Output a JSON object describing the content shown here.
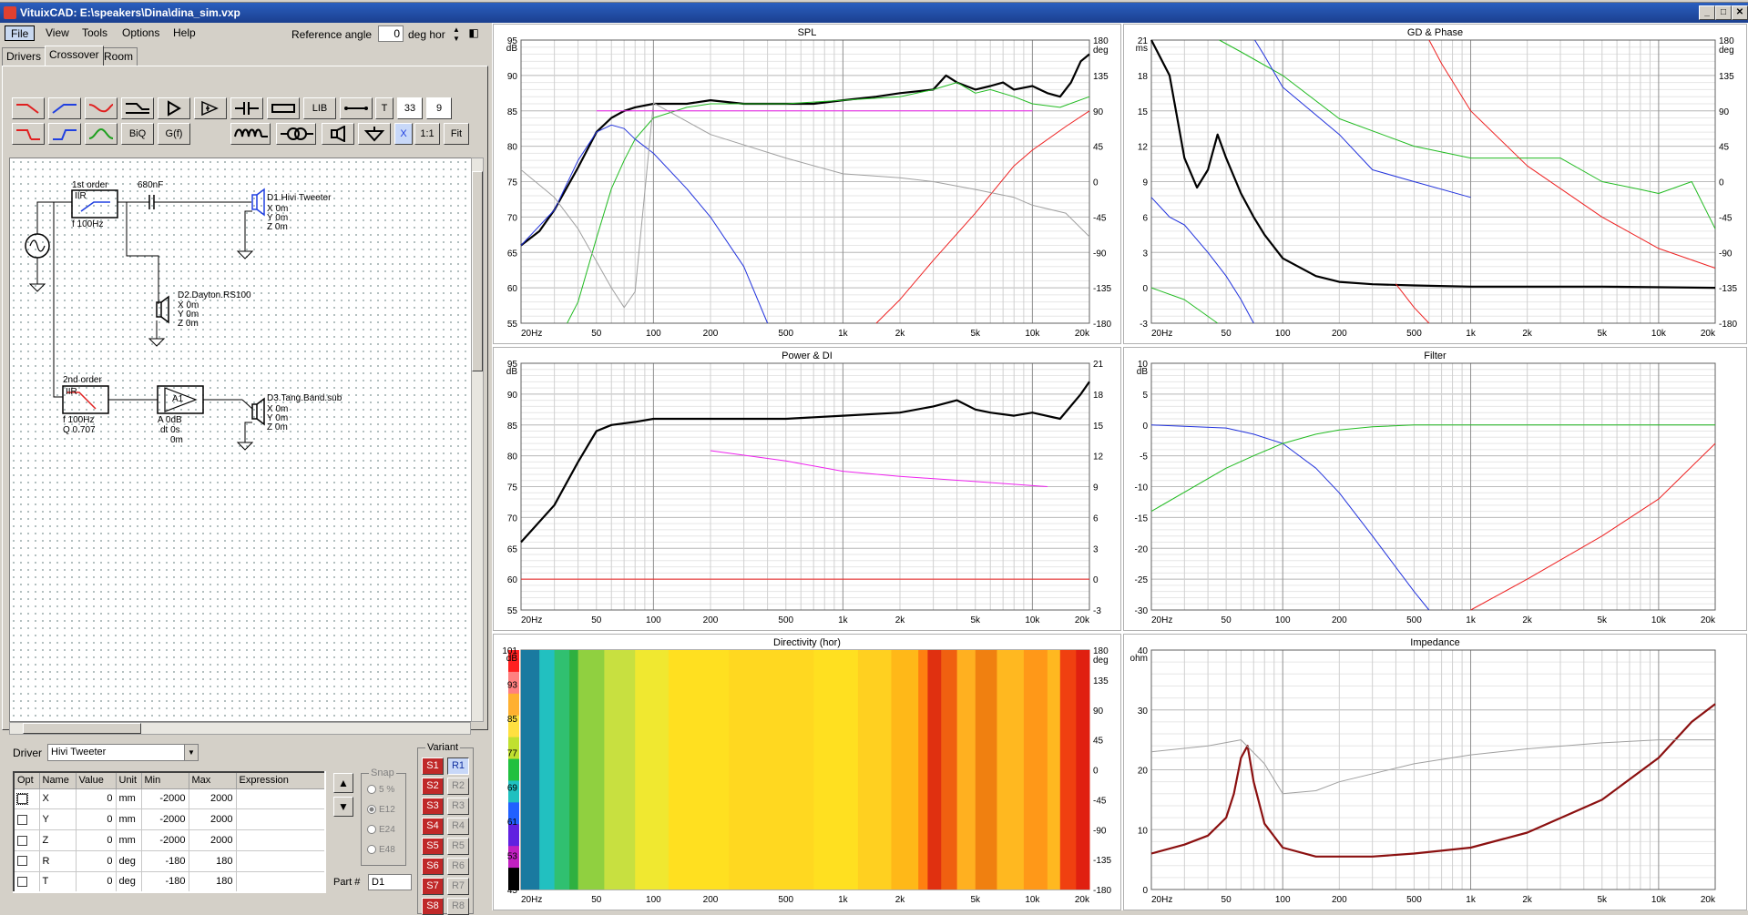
{
  "window": {
    "title": "VituixCAD: E:\\speakers\\Dina\\dina_sim.vxp",
    "controls": [
      "_",
      "□",
      "✕"
    ]
  },
  "menu": [
    "File",
    "View",
    "Tools",
    "Options",
    "Help"
  ],
  "reference": {
    "label": "Reference angle",
    "value": "0",
    "unit": "deg hor"
  },
  "tabs": [
    "Drivers",
    "Crossover",
    "Room"
  ],
  "toolbar": {
    "lib": "LIB",
    "t": "T",
    "num1": "33",
    "num2": "9",
    "biq": "BiQ",
    "gf": "G(f)",
    "onetoone": "1:1",
    "fit": "Fit",
    "x": "X"
  },
  "schematic": {
    "block1": {
      "title": "1st order",
      "type": "IIR",
      "freq": "f  100Hz"
    },
    "cap": "680nF",
    "driver1": {
      "name": "D1.Hivi Tweeter",
      "x": "X 0m",
      "y": "Y 0m",
      "z": "Z 0m"
    },
    "driver2": {
      "name": "D2.Dayton.RS100",
      "x": "X 0m",
      "y": "Y 0m",
      "z": "Z 0m"
    },
    "block2": {
      "title": "2nd order",
      "type": "IIR",
      "freq": "f  100Hz",
      "q": "Q  0.707"
    },
    "amp": {
      "name": "A1",
      "gain": "A  0dB",
      "dt": "dt 0s",
      "dist": "0m"
    },
    "driver3": {
      "name": "D3.Tang.Band.sub",
      "x": "X 0m",
      "y": "Y 0m",
      "z": "Z 0m"
    }
  },
  "driver": {
    "label": "Driver",
    "selected": "Hivi Tweeter"
  },
  "params": {
    "headers": [
      "Opt",
      "Name",
      "Value",
      "Unit",
      "Min",
      "Max",
      "Expression"
    ],
    "rows": [
      {
        "name": "X",
        "value": "0",
        "unit": "mm",
        "min": "-2000",
        "max": "2000"
      },
      {
        "name": "Y",
        "value": "0",
        "unit": "mm",
        "min": "-2000",
        "max": "2000"
      },
      {
        "name": "Z",
        "value": "0",
        "unit": "mm",
        "min": "-2000",
        "max": "2000"
      },
      {
        "name": "R",
        "value": "0",
        "unit": "deg",
        "min": "-180",
        "max": "180"
      },
      {
        "name": "T",
        "value": "0",
        "unit": "deg",
        "min": "-180",
        "max": "180"
      }
    ]
  },
  "snap": {
    "label": "Snap",
    "options": [
      "5 %",
      "E12",
      "E24",
      "E48"
    ]
  },
  "part": {
    "label": "Part #",
    "value": "D1"
  },
  "variant": {
    "label": "Variant",
    "s": [
      "S1",
      "S2",
      "S3",
      "S4",
      "S5",
      "S6",
      "S7",
      "S8"
    ],
    "r": [
      "R1",
      "R2",
      "R3",
      "R4",
      "R5",
      "R6",
      "R7",
      "R8"
    ]
  },
  "freq_ticks": [
    "20Hz",
    "50",
    "100",
    "200",
    "500",
    "1k",
    "2k",
    "5k",
    "10k",
    "20k"
  ],
  "charts": {
    "spl": {
      "title": "SPL",
      "yunit": "dB",
      "y2unit": "deg",
      "yticks": [
        "95",
        "90",
        "85",
        "80",
        "75",
        "70",
        "65",
        "60",
        "55"
      ],
      "y2ticks": [
        "180",
        "135",
        "90",
        "45",
        "0",
        "-45",
        "-90",
        "-135",
        "-180"
      ]
    },
    "gd": {
      "title": "GD & Phase",
      "yunit": "ms",
      "y2unit": "deg",
      "yticks": [
        "21",
        "18",
        "15",
        "12",
        "9",
        "6",
        "3",
        "0",
        "-3"
      ],
      "y2ticks": [
        "180",
        "135",
        "90",
        "45",
        "0",
        "-45",
        "-90",
        "-135",
        "-180"
      ]
    },
    "power": {
      "title": "Power & DI",
      "yunit": "dB",
      "yticks": [
        "95",
        "90",
        "85",
        "80",
        "75",
        "70",
        "65",
        "60",
        "55"
      ],
      "y2ticks": [
        "21",
        "18",
        "15",
        "12",
        "9",
        "6",
        "3",
        "0",
        "-3"
      ]
    },
    "filter": {
      "title": "Filter",
      "yunit": "dB",
      "yticks": [
        "10",
        "5",
        "0",
        "-5",
        "-10",
        "-15",
        "-20",
        "-25",
        "-30"
      ]
    },
    "directivity": {
      "title": "Directivity (hor)",
      "yunit": "dB",
      "y2unit": "deg",
      "yticks": [
        "101",
        "93",
        "85",
        "77",
        "69",
        "61",
        "53",
        "45"
      ],
      "y2ticks": [
        "180",
        "135",
        "90",
        "45",
        "0",
        "-45",
        "-90",
        "-135",
        "-180"
      ]
    },
    "impedance": {
      "title": "Impedance",
      "yunit": "ohm",
      "yticks": [
        "40",
        "30",
        "20",
        "10",
        "0"
      ]
    }
  },
  "colors": {
    "black_curve": "#000000",
    "green": "#22bb22",
    "blue": "#2233dd",
    "red": "#ee2222",
    "gray": "#a0a0a0",
    "magenta": "#ee22ee",
    "impedance": "#8b1010"
  },
  "chart_data": [
    {
      "type": "line",
      "title": "SPL",
      "xscale": "log",
      "xlim": [
        20,
        20000
      ],
      "ylim": [
        55,
        95
      ],
      "y2lim": [
        -180,
        180
      ],
      "series": [
        {
          "color": "#000000",
          "x": [
            20,
            25,
            30,
            40,
            50,
            60,
            70,
            80,
            100,
            150,
            200,
            300,
            500,
            700,
            1000,
            1500,
            2000,
            3000,
            3500,
            4000,
            5000,
            6000,
            7000,
            8000,
            10000,
            12000,
            14000,
            16000,
            18000,
            20000
          ],
          "values": [
            66,
            68,
            71,
            77,
            82,
            84,
            85,
            85.5,
            86,
            86,
            86.5,
            86,
            86,
            86,
            86.5,
            87,
            87.5,
            88,
            90,
            89,
            88,
            88.5,
            89,
            88,
            88.5,
            87.5,
            87,
            89,
            92,
            93
          ]
        },
        {
          "color": "#22bb22",
          "x": [
            35,
            40,
            50,
            60,
            70,
            80,
            100,
            150,
            200,
            300,
            500,
            1000,
            2000,
            3000,
            4000,
            5000,
            6000,
            8000,
            10000,
            14000,
            20000
          ],
          "values": [
            55,
            58,
            67,
            74,
            78,
            81,
            84,
            85.5,
            86,
            86,
            86,
            86.5,
            87,
            88,
            89,
            87.5,
            88,
            87,
            86,
            85.5,
            87
          ]
        },
        {
          "color": "#2233dd",
          "x": [
            20,
            30,
            40,
            50,
            60,
            70,
            80,
            100,
            150,
            200,
            300,
            400
          ],
          "values": [
            66,
            71,
            78,
            82,
            83,
            82.5,
            81,
            79,
            74,
            70,
            63,
            55
          ]
        },
        {
          "color": "#ee2222",
          "x": [
            1500,
            2000,
            3000,
            5000,
            8000,
            10000,
            15000,
            20000
          ],
          "values": [
            -180,
            -150,
            -100,
            -40,
            20,
            40,
            70,
            90
          ]
        },
        {
          "color": "#a0a0a0",
          "x": [
            20,
            30,
            40,
            60,
            70,
            80,
            100,
            200,
            500,
            1000,
            2000,
            3000,
            5000,
            8000,
            10000,
            15000,
            20000
          ],
          "values": [
            15,
            -20,
            -60,
            -135,
            -160,
            -140,
            100,
            60,
            30,
            10,
            5,
            0,
            -10,
            -20,
            -30,
            -40,
            -70
          ]
        },
        {
          "color": "#ee22ee",
          "x": [
            50,
            10000
          ],
          "values": [
            85,
            85
          ]
        }
      ]
    },
    {
      "type": "line",
      "title": "GD & Phase",
      "xscale": "log",
      "xlim": [
        20,
        20000
      ],
      "ylim": [
        -3,
        21
      ],
      "y2lim": [
        -180,
        180
      ],
      "series": [
        {
          "color": "#000000",
          "x": [
            20,
            25,
            30,
            35,
            40,
            45,
            50,
            60,
            70,
            80,
            100,
            150,
            200,
            300,
            500,
            1000,
            2000,
            5000,
            20000
          ],
          "values": [
            21,
            18,
            11,
            8.5,
            10,
            13,
            11,
            8,
            6,
            4.5,
            2.5,
            1,
            0.5,
            0.3,
            0.2,
            0.1,
            0.1,
            0.1,
            0
          ]
        },
        {
          "color": "#22bb22",
          "x": [
            20,
            30,
            45,
            46,
            60,
            100,
            200,
            500,
            1000,
            2000,
            3000,
            5000,
            8000,
            10000,
            15000,
            20000
          ],
          "values": [
            -135,
            -150,
            -180,
            180,
            165,
            135,
            80,
            45,
            30,
            30,
            30,
            0,
            -10,
            -15,
            0,
            -60
          ]
        },
        {
          "color": "#2233dd",
          "x": [
            20,
            25,
            30,
            40,
            50,
            60,
            70,
            71,
            80,
            100,
            200,
            300,
            500,
            1000
          ],
          "values": [
            -20,
            -45,
            -55,
            -90,
            -120,
            -150,
            -180,
            180,
            160,
            120,
            60,
            15,
            0,
            -20
          ]
        },
        {
          "color": "#ee2222",
          "x": [
            400,
            500,
            600,
            601,
            700,
            1000,
            2000,
            5000,
            10000,
            20000
          ],
          "values": [
            -130,
            -160,
            -180,
            180,
            150,
            90,
            20,
            -45,
            -85,
            -110
          ]
        }
      ]
    },
    {
      "type": "line",
      "title": "Power & DI",
      "xscale": "log",
      "xlim": [
        20,
        20000
      ],
      "ylim": [
        55,
        95
      ],
      "y2lim": [
        -3,
        21
      ],
      "series": [
        {
          "color": "#000000",
          "x": [
            20,
            30,
            40,
            50,
            60,
            80,
            100,
            200,
            500,
            1000,
            2000,
            3000,
            4000,
            5000,
            6000,
            8000,
            10000,
            14000,
            18000,
            20000
          ],
          "values": [
            66,
            72,
            79,
            84,
            85,
            85.5,
            86,
            86,
            86,
            86.5,
            87,
            88,
            89,
            87.5,
            87,
            86.5,
            87,
            86,
            90,
            92
          ]
        },
        {
          "color": "#ee22ee",
          "axis": "y2",
          "x": [
            200,
            500,
            1000,
            2000,
            5000,
            12000
          ],
          "values": [
            12.5,
            11.5,
            10.5,
            10,
            9.5,
            9
          ]
        },
        {
          "color": "#ee2222",
          "x": [
            20,
            20000
          ],
          "values": [
            60,
            60
          ]
        }
      ]
    },
    {
      "type": "line",
      "title": "Filter",
      "xscale": "log",
      "xlim": [
        20,
        20000
      ],
      "ylim": [
        -30,
        10
      ],
      "series": [
        {
          "color": "#2233dd",
          "x": [
            20,
            50,
            70,
            100,
            150,
            200,
            300,
            500,
            600
          ],
          "values": [
            0,
            -0.5,
            -1.5,
            -3,
            -7,
            -11,
            -18,
            -27,
            -30
          ]
        },
        {
          "color": "#22bb22",
          "x": [
            20,
            50,
            70,
            100,
            150,
            200,
            300,
            500,
            1000,
            20000
          ],
          "values": [
            -14,
            -7,
            -5,
            -3,
            -1.5,
            -0.8,
            -0.3,
            0,
            0,
            0
          ]
        },
        {
          "color": "#ee2222",
          "x": [
            1000,
            2000,
            5000,
            10000,
            20000
          ],
          "values": [
            -30,
            -25,
            -18,
            -12,
            -3
          ]
        }
      ]
    },
    {
      "type": "heatmap",
      "title": "Directivity (hor)",
      "xscale": "log",
      "xlim": [
        20,
        20000
      ],
      "zlim": [
        45,
        101
      ]
    },
    {
      "type": "line",
      "title": "Impedance",
      "xscale": "log",
      "xlim": [
        20,
        20000
      ],
      "ylim": [
        0,
        40
      ],
      "series": [
        {
          "color": "#8b1010",
          "x": [
            20,
            30,
            40,
            50,
            55,
            60,
            65,
            70,
            80,
            100,
            150,
            200,
            300,
            500,
            1000,
            2000,
            5000,
            10000,
            15000,
            20000
          ],
          "values": [
            6,
            7.5,
            9,
            12,
            16,
            22,
            24,
            18,
            11,
            7,
            5.5,
            5.5,
            5.5,
            6,
            7,
            9.5,
            15,
            22,
            28,
            31
          ]
        },
        {
          "color": "#a0a0a0",
          "x": [
            20,
            40,
            60,
            80,
            100,
            150,
            200,
            500,
            1000,
            2000,
            5000,
            10000,
            20000
          ],
          "values": [
            23,
            24,
            25,
            21,
            16,
            16.5,
            18,
            21,
            22.5,
            23.5,
            24.5,
            25,
            25
          ]
        }
      ]
    }
  ]
}
